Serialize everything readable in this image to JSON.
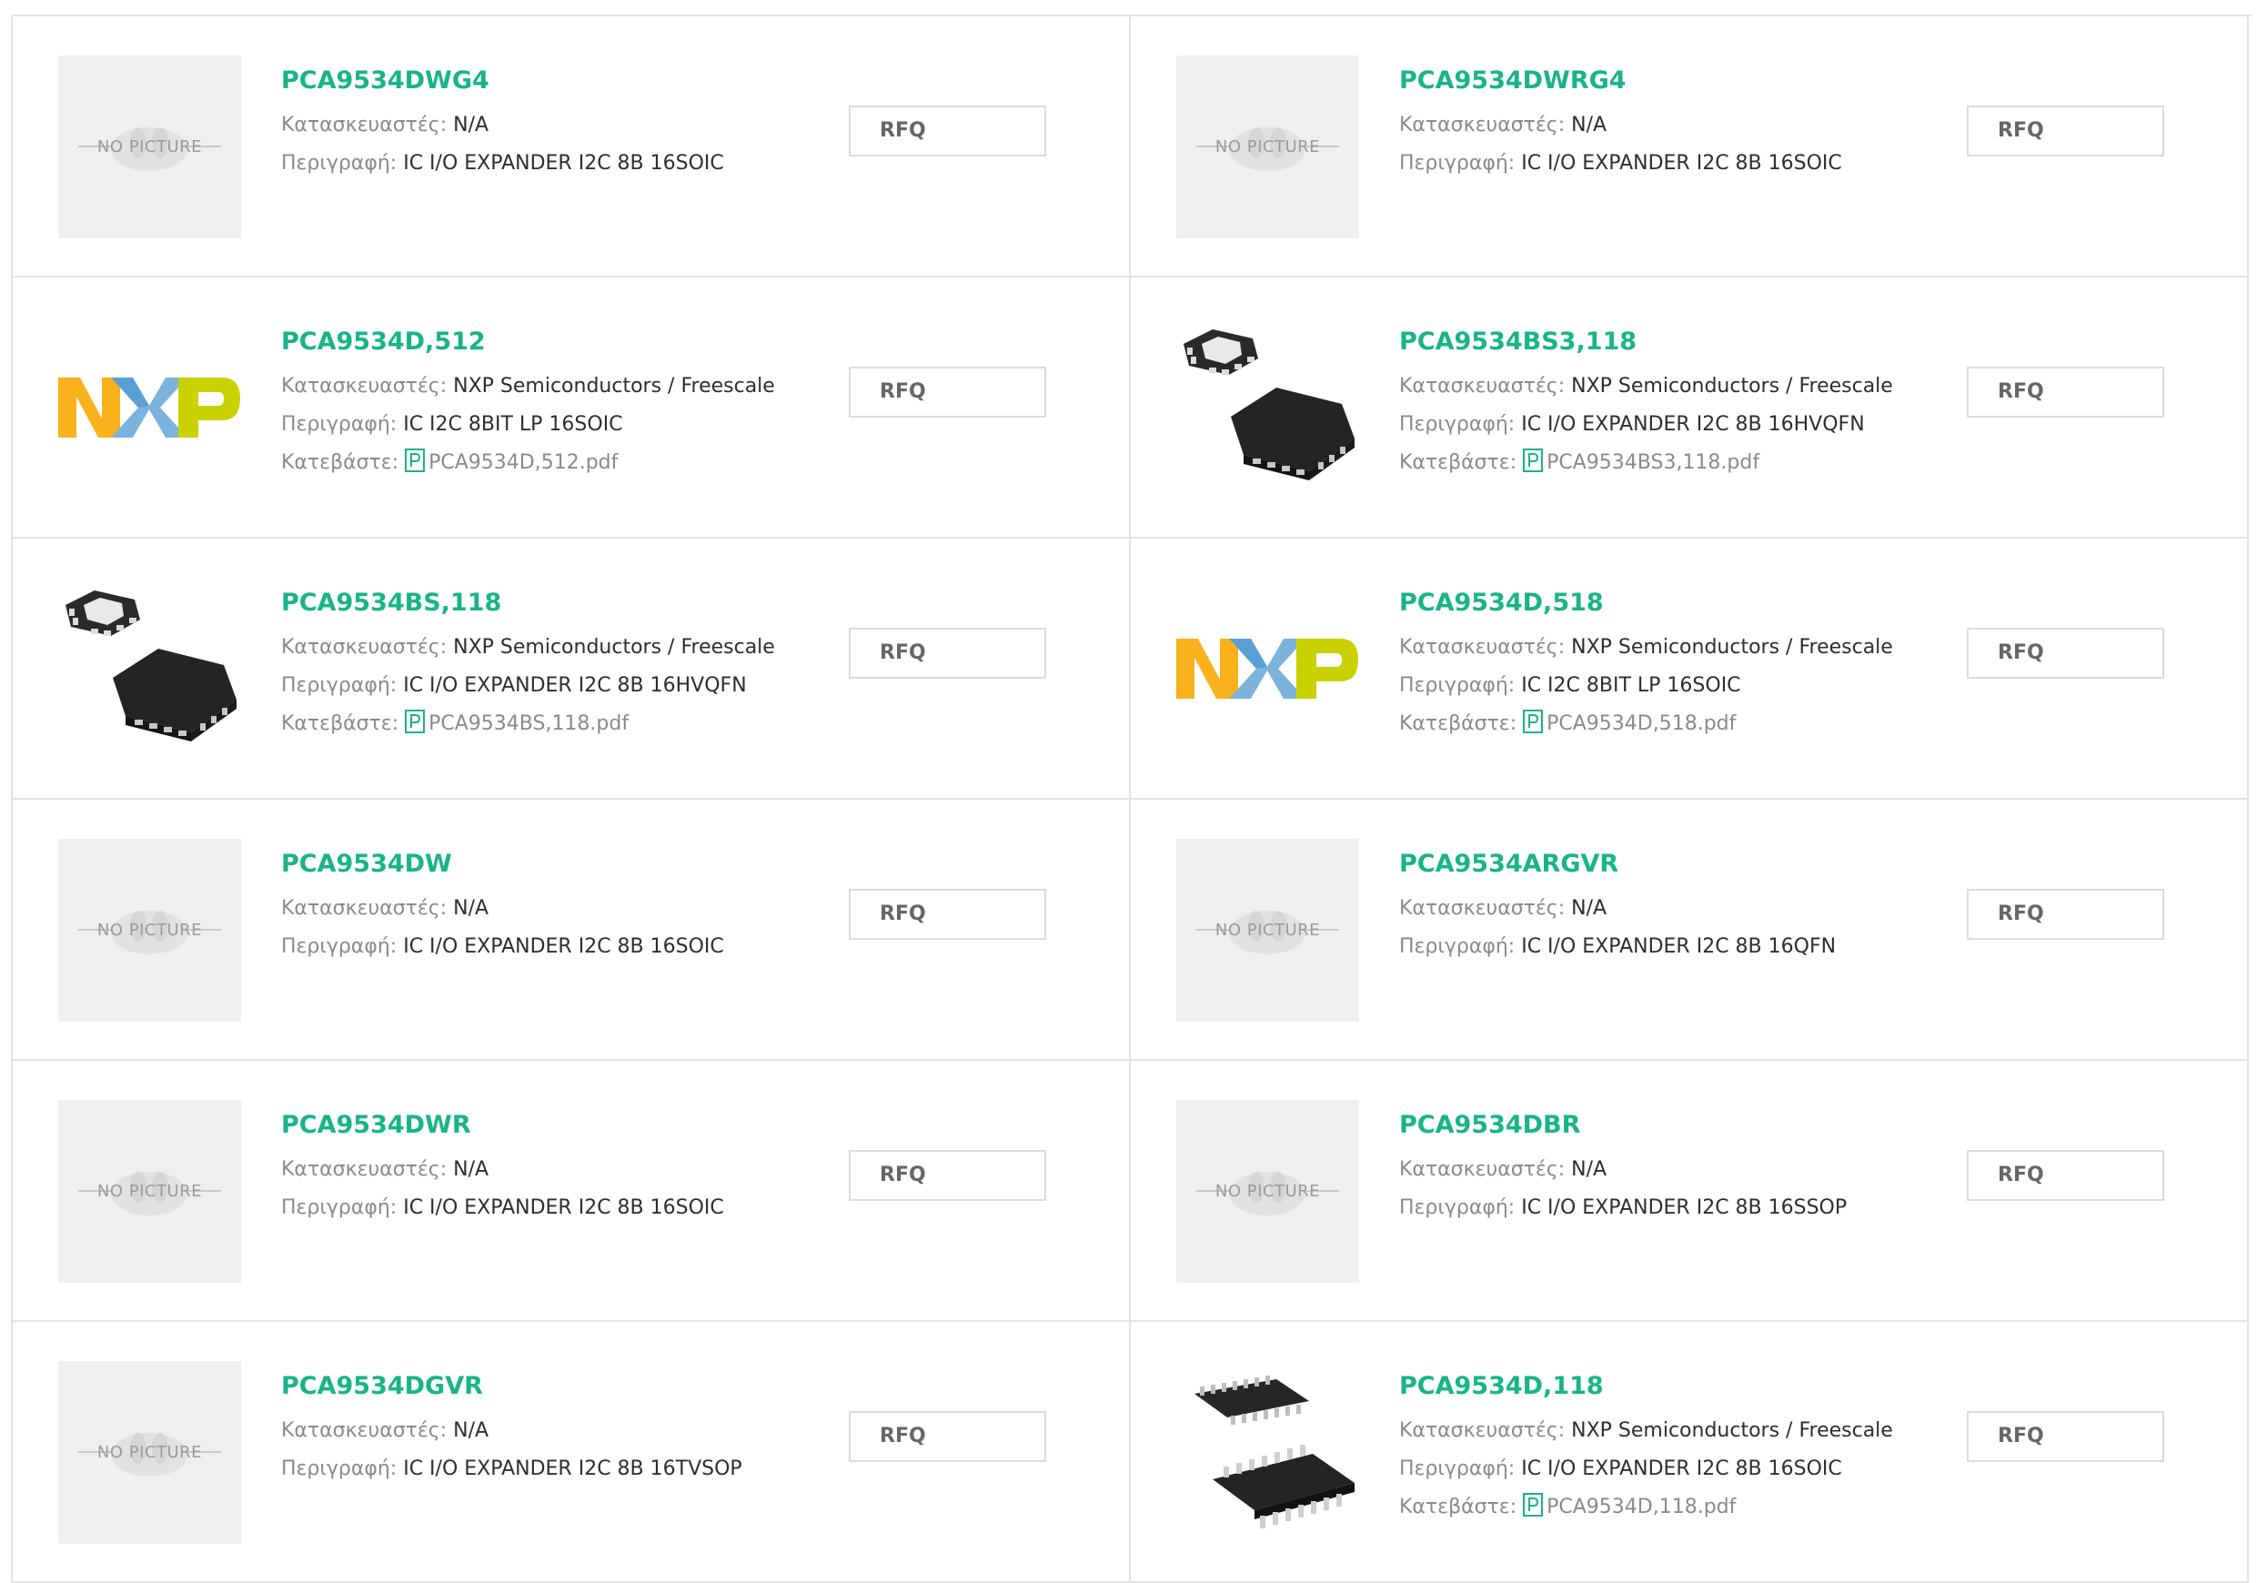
{
  "labels": {
    "manufacturer": "Κατασκευαστές:",
    "description": "Περιγραφή:",
    "download": "Κατεβάστε:",
    "rfq": "RFQ",
    "no_picture": "NO PICTURE"
  },
  "colors": {
    "accent": "#18b486",
    "label": "#8a8a8a",
    "text": "#2e2e2e",
    "border": "#e3e3e3",
    "nxp_orange": "#f9b21b",
    "nxp_blue": "#7bb3dd",
    "nxp_green": "#c9d200"
  },
  "products": [
    {
      "name": "PCA9534DWG4",
      "manufacturer": "N/A",
      "description": "IC I/O EXPANDER I2C 8B 16SOIC",
      "image": "no-picture"
    },
    {
      "name": "PCA9534DWRG4",
      "manufacturer": "N/A",
      "description": "IC I/O EXPANDER I2C 8B 16SOIC",
      "image": "no-picture"
    },
    {
      "name": "PCA9534D,512",
      "manufacturer": "NXP Semiconductors / Freescale",
      "description": "IC I2C 8BIT LP 16SOIC",
      "pdf": "PCA9534D,512.pdf",
      "image": "nxp-logo"
    },
    {
      "name": "PCA9534BS3,118",
      "manufacturer": "NXP Semiconductors / Freescale",
      "description": "IC I/O EXPANDER I2C 8B 16HVQFN",
      "pdf": "PCA9534BS3,118.pdf",
      "image": "qfn-chip"
    },
    {
      "name": "PCA9534BS,118",
      "manufacturer": "NXP Semiconductors / Freescale",
      "description": "IC I/O EXPANDER I2C 8B 16HVQFN",
      "pdf": "PCA9534BS,118.pdf",
      "image": "qfn-chip"
    },
    {
      "name": "PCA9534D,518",
      "manufacturer": "NXP Semiconductors / Freescale",
      "description": "IC I2C 8BIT LP 16SOIC",
      "pdf": "PCA9534D,518.pdf",
      "image": "nxp-logo"
    },
    {
      "name": "PCA9534DW",
      "manufacturer": "N/A",
      "description": "IC I/O EXPANDER I2C 8B 16SOIC",
      "image": "no-picture"
    },
    {
      "name": "PCA9534ARGVR",
      "manufacturer": "N/A",
      "description": "IC I/O EXPANDER I2C 8B 16QFN",
      "image": "no-picture"
    },
    {
      "name": "PCA9534DWR",
      "manufacturer": "N/A",
      "description": "IC I/O EXPANDER I2C 8B 16SOIC",
      "image": "no-picture"
    },
    {
      "name": "PCA9534DBR",
      "manufacturer": "N/A",
      "description": "IC I/O EXPANDER I2C 8B 16SSOP",
      "image": "no-picture"
    },
    {
      "name": "PCA9534DGVR",
      "manufacturer": "N/A",
      "description": "IC I/O EXPANDER I2C 8B 16TVSOP",
      "image": "no-picture"
    },
    {
      "name": "PCA9534D,118",
      "manufacturer": "NXP Semiconductors / Freescale",
      "description": "IC I/O EXPANDER I2C 8B 16SOIC",
      "pdf": "PCA9534D,118.pdf",
      "image": "soic-chip"
    }
  ]
}
